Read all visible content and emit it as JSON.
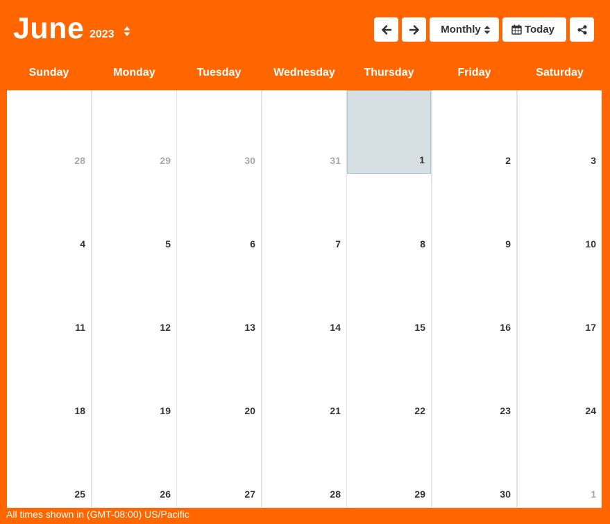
{
  "header": {
    "month": "June",
    "year": "2023",
    "view_label": "Monthly",
    "today_label": "Today"
  },
  "colors": {
    "background": "#ff6600",
    "cell": "#ffffff",
    "today_cell": "#d6dfe3",
    "day_number": "#333333",
    "other_month_number": "#a6a6a6"
  },
  "icons": {
    "prev": "arrow-left-icon",
    "next": "arrow-right-icon",
    "year_sort": "sort-icon",
    "view_sort": "sort-icon",
    "today": "calendar-icon",
    "share": "share-icon"
  },
  "weekdays": [
    "Sunday",
    "Monday",
    "Tuesday",
    "Wednesday",
    "Thursday",
    "Friday",
    "Saturday"
  ],
  "weeks": [
    [
      {
        "day": "28",
        "other": true
      },
      {
        "day": "29",
        "other": true
      },
      {
        "day": "30",
        "other": true
      },
      {
        "day": "31",
        "other": true
      },
      {
        "day": "1",
        "today": true
      },
      {
        "day": "2"
      },
      {
        "day": "3"
      }
    ],
    [
      {
        "day": "4"
      },
      {
        "day": "5"
      },
      {
        "day": "6"
      },
      {
        "day": "7"
      },
      {
        "day": "8"
      },
      {
        "day": "9"
      },
      {
        "day": "10"
      }
    ],
    [
      {
        "day": "11"
      },
      {
        "day": "12"
      },
      {
        "day": "13"
      },
      {
        "day": "14"
      },
      {
        "day": "15"
      },
      {
        "day": "16"
      },
      {
        "day": "17"
      }
    ],
    [
      {
        "day": "18"
      },
      {
        "day": "19"
      },
      {
        "day": "20"
      },
      {
        "day": "21"
      },
      {
        "day": "22"
      },
      {
        "day": "23"
      },
      {
        "day": "24"
      }
    ],
    [
      {
        "day": "25"
      },
      {
        "day": "26"
      },
      {
        "day": "27"
      },
      {
        "day": "28"
      },
      {
        "day": "29"
      },
      {
        "day": "30"
      },
      {
        "day": "1",
        "other": true
      }
    ]
  ],
  "footer": {
    "timezone_note": "All times shown in (GMT-08:00) US/Pacific"
  }
}
